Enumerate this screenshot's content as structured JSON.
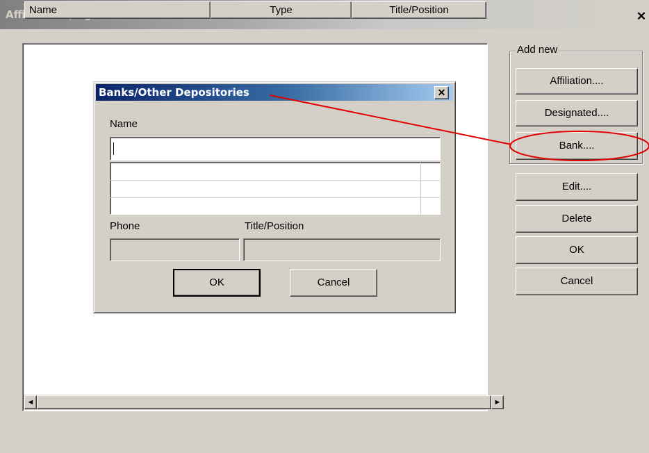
{
  "window": {
    "title": "Affiliations, Agents & Banks Related to the Committee",
    "close_glyph": "✕"
  },
  "list": {
    "columns": [
      "Name",
      "Type",
      "Title/Position"
    ],
    "rows": []
  },
  "scrollbar": {
    "left_arrow": "◄",
    "right_arrow": "►"
  },
  "add_new": {
    "label": "Add new",
    "affiliation": "Affiliation....",
    "designated": "Designated....",
    "bank": "Bank...."
  },
  "actions": {
    "edit": "Edit....",
    "delete": "Delete",
    "ok": "OK",
    "cancel": "Cancel"
  },
  "dialog": {
    "title": "Banks/Other Depositories",
    "close_glyph": "✕",
    "name_label": "Name",
    "name_value": "",
    "phone_label": "Phone",
    "phone_value": "",
    "title_label": "Title/Position",
    "title_value": "",
    "ok": "OK",
    "cancel": "Cancel"
  },
  "annotation": {
    "color": "#e00000"
  }
}
